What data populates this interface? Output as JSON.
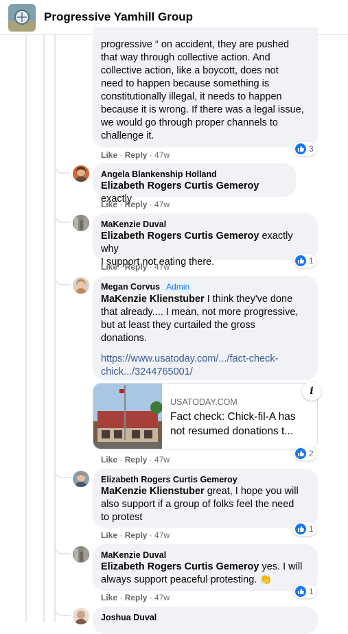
{
  "header": {
    "group_name": "Progressive Yamhill Group"
  },
  "comments": [
    {
      "text_lines": [
        "progressive “ on accident, they are pushed",
        "that way through collective action. And",
        "collective action, like a boycott, does not",
        "need to happen because something is",
        "constitutionally illegal, it needs to happen",
        "because it is wrong. If there was a legal issue,",
        "we would go through proper channels to",
        "challenge it."
      ],
      "like": "Like",
      "reply": "Reply",
      "time": "47w",
      "reactions": "3"
    },
    {
      "author": "Angela Blankenship Holland",
      "mention": "Elizabeth Rogers Curtis Gemeroy",
      "text": " exactly",
      "like": "Like",
      "reply": "Reply",
      "time": "47w"
    },
    {
      "author": "MaKenzie Duval",
      "mention": "Elizabeth Rogers Curtis Gemeroy",
      "text": " exactly why",
      "text2": "I support not eating there.",
      "like": "Like",
      "reply": "Reply",
      "time": "47w",
      "reactions": "1"
    },
    {
      "author": "Megan Corvus",
      "badge": "Admin",
      "mention": "MaKenzie Klienstuber",
      "text": " I think they've done",
      "text_lines": [
        "that already.... I mean, not more progressive,",
        "but at least they curtailed the gross",
        "donations."
      ],
      "link1": "https://www.usatoday.com/.../fact-check-",
      "link2": "chick.../3244765001/",
      "card": {
        "domain": "USATODAY.COM",
        "title": "Fact check: Chick-fil-A has not resumed donations t..."
      },
      "like": "Like",
      "reply": "Reply",
      "time": "47w",
      "reactions": "2"
    },
    {
      "author": "Elizabeth Rogers Curtis Gemeroy",
      "mention": "MaKenzie Klienstuber",
      "text": " great, I hope you will",
      "text_lines": [
        "also support if a group of folks feel the need",
        "to protest"
      ],
      "like": "Like",
      "reply": "Reply",
      "time": "47w",
      "reactions": "1"
    },
    {
      "author": "MaKenzie Duval",
      "mention": "Elizabeth Rogers Curtis Gemeroy",
      "text": " yes. I will",
      "text2": "always support peaceful protesting. 👏",
      "like": "Like",
      "reply": "Reply",
      "time": "47w",
      "reactions": "1"
    },
    {
      "author": "Joshua Duval"
    }
  ],
  "colors": {
    "like_blue": "#1877f2",
    "bubble": "#f0f2f5",
    "meta": "#65676b",
    "link": "#385898"
  },
  "icons": {
    "reaction": "like-icon",
    "info": "info-icon"
  }
}
